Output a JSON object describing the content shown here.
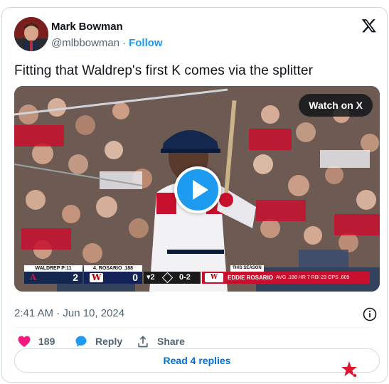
{
  "author": {
    "name": "Mark Bowman",
    "handle": "@mlbbowman",
    "separator": "·",
    "follow_label": "Follow"
  },
  "tweet": {
    "text": "Fitting that Waldrep's first K comes via the splitter",
    "timestamp": "2:41 AM · Jun 10, 2024"
  },
  "media": {
    "watch_label": "Watch on X",
    "scorebug": {
      "away": {
        "pitcher": "WALDREP P:11",
        "logo_text": "A",
        "runs": "2"
      },
      "home": {
        "pitcher": "4. ROSARIO .188",
        "logo_text": "W",
        "runs": "0"
      },
      "inning": "▾2",
      "count": "0-2",
      "season_label": "THIS SEASON",
      "batter_logo": "W",
      "batter_name": "EDDIE ROSARIO",
      "batter_stats": "AVG .188  HR 7  RBI 23  OPS .609"
    }
  },
  "actions": {
    "like_count": "189",
    "reply_label": "Reply",
    "share_label": "Share",
    "read_replies_label": "Read 4 replies"
  },
  "colors": {
    "accent": "#1d9bf0",
    "like": "#f91880",
    "link": "#006fd6",
    "secondary_text": "#536471",
    "border": "#cfd9de"
  }
}
